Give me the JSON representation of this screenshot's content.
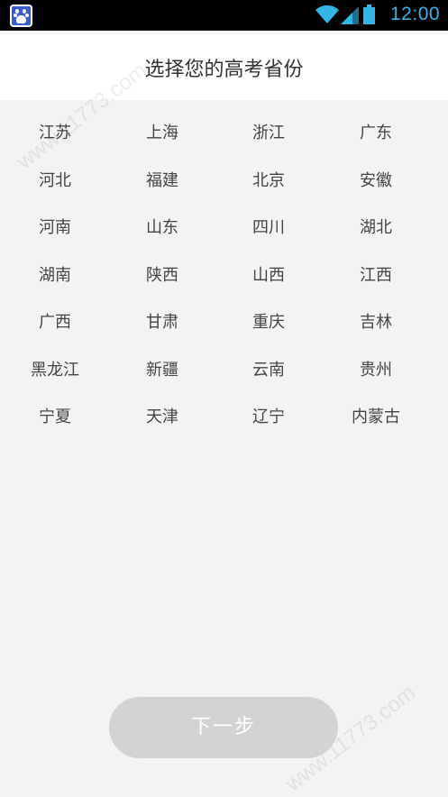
{
  "status_bar": {
    "time": "12:00",
    "icons": [
      "baidu-app-icon",
      "wifi-icon",
      "signal-icon",
      "battery-icon"
    ]
  },
  "header": {
    "title": "选择您的高考省份"
  },
  "provinces": [
    "江苏",
    "上海",
    "浙江",
    "广东",
    "河北",
    "福建",
    "北京",
    "安徽",
    "河南",
    "山东",
    "四川",
    "湖北",
    "湖南",
    "陕西",
    "山西",
    "江西",
    "广西",
    "甘肃",
    "重庆",
    "吉林",
    "黑龙江",
    "新疆",
    "云南",
    "贵州",
    "宁夏",
    "天津",
    "辽宁",
    "内蒙古"
  ],
  "next_button": {
    "label": "下一步"
  },
  "watermark": {
    "text": "www.11773.com"
  },
  "colors": {
    "accent": "#33b5e5",
    "button_disabled": "#d3d3d3",
    "background": "#f3f3f3"
  }
}
